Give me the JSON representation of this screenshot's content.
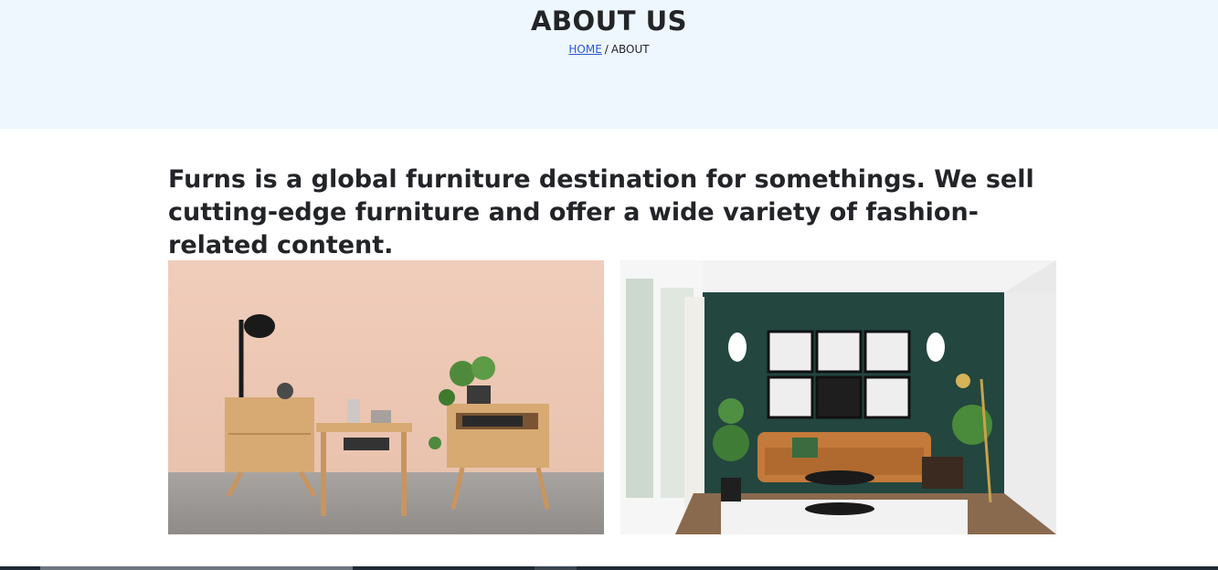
{
  "hero": {
    "title": "ABOUT US",
    "breadcrumb": {
      "home_label": "HOME",
      "separator": "/",
      "current_label": "ABOUT"
    }
  },
  "intro": {
    "text": "Furns is a global furniture destination for somethings. We sell cutting-edge furniture and offer a wide variety of fashion-related content."
  },
  "gallery": {
    "images": [
      {
        "subject": "bedside-tables-photo"
      },
      {
        "subject": "living-room-photo"
      }
    ]
  },
  "colors": {
    "hero_bg": "#eef6fe",
    "link": "#2a5bd7",
    "text": "#222428"
  }
}
